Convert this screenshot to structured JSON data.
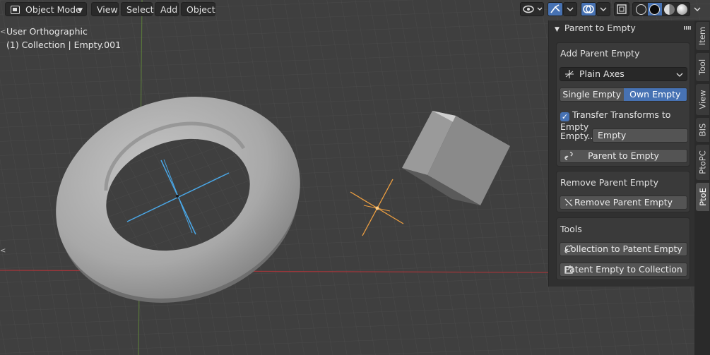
{
  "header": {
    "mode_label": "Object Mode",
    "menus": [
      "View",
      "Select",
      "Add",
      "Object"
    ],
    "icons": [
      "visibility-icon",
      "gizmo-icon",
      "overlay-icon",
      "xray-icon",
      "wireframe-shading-icon",
      "solid-shading-icon",
      "material-shading-icon",
      "rendered-shading-icon"
    ]
  },
  "viewport": {
    "view_name": "User Orthographic",
    "collection_info": "(1) Collection | Empty.001"
  },
  "npanel": {
    "title": "Parent to Empty",
    "add_section": {
      "label": "Add Parent Empty",
      "empty_type": "Plain Axes",
      "mode_options": [
        "Single Empty",
        "Own Empty"
      ],
      "mode_selected": "Own Empty",
      "transfer_label": "Transfer Transforms to Empty",
      "transfer_checked": true,
      "empty_field_label": "Empty...",
      "empty_field_value": "Empty",
      "parent_button": "Parent to Empty"
    },
    "remove_section": {
      "label": "Remove Parent Empty",
      "remove_button": "Remove Parent Empty"
    },
    "tools_section": {
      "label": "Tools",
      "collection_button": "Collection to Patent Empty",
      "empty_button": "Patent Empty to Collection"
    }
  },
  "tabs": [
    {
      "label": "Item",
      "active": false
    },
    {
      "label": "Tool",
      "active": false
    },
    {
      "label": "View",
      "active": false
    },
    {
      "label": "BIS",
      "active": false
    },
    {
      "label": "PtoPC",
      "active": false
    },
    {
      "label": "PtoE",
      "active": true
    }
  ],
  "colors": {
    "accent": "#4772b3",
    "selected_empty": "#f0a040",
    "active_empty": "#4aa8e8",
    "x_axis": "#a0363a",
    "y_axis": "#6a9a3a"
  }
}
